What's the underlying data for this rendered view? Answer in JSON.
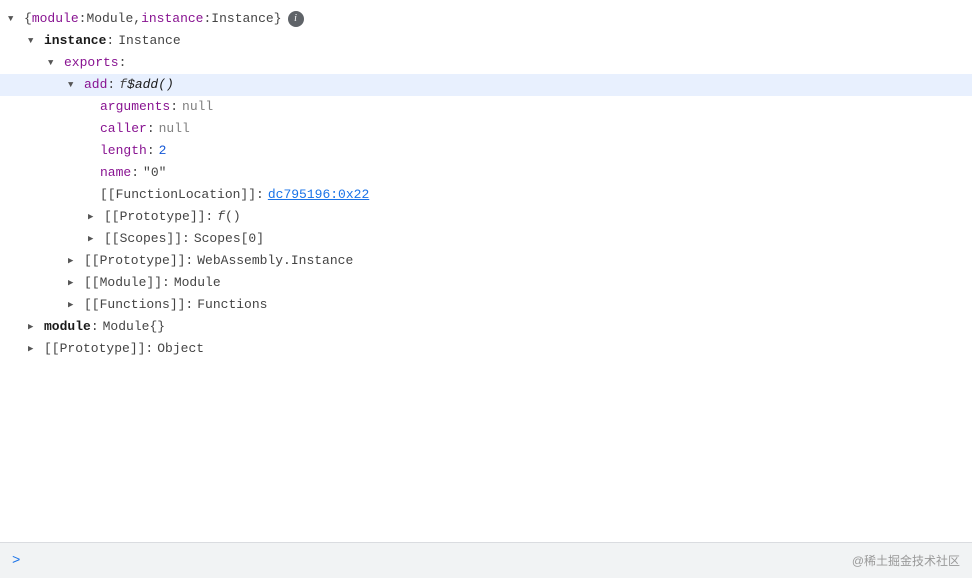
{
  "console": {
    "lines": [
      {
        "id": "root",
        "indent": "indent-0",
        "toggle": "expanded",
        "highlighted": false,
        "content": [
          {
            "type": "punctuation",
            "text": "{"
          },
          {
            "type": "key-module",
            "text": "module"
          },
          {
            "type": "punctuation",
            "text": ":"
          },
          {
            "type": "space"
          },
          {
            "type": "val-normal",
            "text": "Module"
          },
          {
            "type": "punctuation",
            "text": ","
          },
          {
            "type": "space"
          },
          {
            "type": "key-instance",
            "text": "instance"
          },
          {
            "type": "punctuation",
            "text": ":"
          },
          {
            "type": "space"
          },
          {
            "type": "val-normal",
            "text": "Instance"
          },
          {
            "type": "punctuation",
            "text": "}"
          },
          {
            "type": "info-badge",
            "text": "i"
          }
        ]
      },
      {
        "id": "instance",
        "indent": "indent-1",
        "toggle": "expanded",
        "highlighted": false,
        "content": [
          {
            "type": "key-bold",
            "text": "instance"
          },
          {
            "type": "colon",
            "text": ":"
          },
          {
            "type": "space"
          },
          {
            "type": "val-normal",
            "text": "Instance"
          }
        ]
      },
      {
        "id": "exports",
        "indent": "indent-2",
        "toggle": "expanded",
        "highlighted": false,
        "content": [
          {
            "type": "key-purple",
            "text": "exports"
          },
          {
            "type": "colon",
            "text": ":"
          }
        ]
      },
      {
        "id": "add",
        "indent": "indent-3",
        "toggle": "expanded",
        "highlighted": true,
        "content": [
          {
            "type": "key-add",
            "text": "add"
          },
          {
            "type": "colon",
            "text": ":"
          },
          {
            "type": "space"
          },
          {
            "type": "f-italic",
            "text": "f"
          },
          {
            "type": "space"
          },
          {
            "type": "val-function",
            "text": "$add()"
          }
        ]
      },
      {
        "id": "arguments",
        "indent": "indent-4",
        "toggle": "none",
        "highlighted": false,
        "content": [
          {
            "type": "key-purple",
            "text": "arguments"
          },
          {
            "type": "colon",
            "text": ":"
          },
          {
            "type": "space"
          },
          {
            "type": "val-null",
            "text": "null"
          }
        ]
      },
      {
        "id": "caller",
        "indent": "indent-4",
        "toggle": "none",
        "highlighted": false,
        "content": [
          {
            "type": "key-purple",
            "text": "caller"
          },
          {
            "type": "colon",
            "text": ":"
          },
          {
            "type": "space"
          },
          {
            "type": "val-null",
            "text": "null"
          }
        ]
      },
      {
        "id": "length",
        "indent": "indent-4",
        "toggle": "none",
        "highlighted": false,
        "content": [
          {
            "type": "key-purple",
            "text": "length"
          },
          {
            "type": "colon",
            "text": ":"
          },
          {
            "type": "space"
          },
          {
            "type": "val-number",
            "text": "2"
          }
        ]
      },
      {
        "id": "name",
        "indent": "indent-4",
        "toggle": "none",
        "highlighted": false,
        "content": [
          {
            "type": "key-purple",
            "text": "name"
          },
          {
            "type": "colon",
            "text": ":"
          },
          {
            "type": "space"
          },
          {
            "type": "val-string",
            "text": "\"0\""
          }
        ]
      },
      {
        "id": "funclocation",
        "indent": "indent-4",
        "toggle": "none",
        "highlighted": false,
        "content": [
          {
            "type": "val-normal",
            "text": "[[FunctionLocation]]"
          },
          {
            "type": "colon",
            "text": ":"
          },
          {
            "type": "space"
          },
          {
            "type": "val-link",
            "text": "dc795196:0x22"
          }
        ]
      },
      {
        "id": "prototype-func",
        "indent": "indent-4",
        "toggle": "collapsed",
        "highlighted": false,
        "content": [
          {
            "type": "val-normal",
            "text": "[[Prototype]]"
          },
          {
            "type": "colon",
            "text": ":"
          },
          {
            "type": "space"
          },
          {
            "type": "f-italic",
            "text": "f"
          },
          {
            "type": "space"
          },
          {
            "type": "val-normal",
            "text": "()"
          }
        ]
      },
      {
        "id": "scopes",
        "indent": "indent-4",
        "toggle": "collapsed",
        "highlighted": false,
        "content": [
          {
            "type": "val-normal",
            "text": "[[Scopes]]"
          },
          {
            "type": "colon",
            "text": ":"
          },
          {
            "type": "space"
          },
          {
            "type": "val-normal",
            "text": "Scopes[0]"
          }
        ]
      },
      {
        "id": "prototype-instance",
        "indent": "indent-3",
        "toggle": "collapsed",
        "highlighted": false,
        "content": [
          {
            "type": "val-normal",
            "text": "[[Prototype]]"
          },
          {
            "type": "colon",
            "text": ":"
          },
          {
            "type": "space"
          },
          {
            "type": "val-normal",
            "text": "WebAssembly.Instance"
          }
        ]
      },
      {
        "id": "module-prop",
        "indent": "indent-3",
        "toggle": "collapsed",
        "highlighted": false,
        "content": [
          {
            "type": "val-normal",
            "text": "[[Module]]"
          },
          {
            "type": "colon",
            "text": ":"
          },
          {
            "type": "space"
          },
          {
            "type": "val-normal",
            "text": "Module"
          }
        ]
      },
      {
        "id": "functions",
        "indent": "indent-3",
        "toggle": "collapsed",
        "highlighted": false,
        "content": [
          {
            "type": "val-normal",
            "text": "[[Functions]]"
          },
          {
            "type": "colon",
            "text": ":"
          },
          {
            "type": "space"
          },
          {
            "type": "val-normal",
            "text": "Functions"
          }
        ]
      },
      {
        "id": "module-root",
        "indent": "indent-1",
        "toggle": "collapsed",
        "highlighted": false,
        "content": [
          {
            "type": "key-bold",
            "text": "module"
          },
          {
            "type": "colon",
            "text": ":"
          },
          {
            "type": "space"
          },
          {
            "type": "val-normal",
            "text": "Module"
          },
          {
            "type": "space"
          },
          {
            "type": "punctuation",
            "text": "{}"
          }
        ]
      },
      {
        "id": "prototype-root",
        "indent": "indent-1",
        "toggle": "collapsed",
        "highlighted": false,
        "content": [
          {
            "type": "val-normal",
            "text": "[[Prototype]]"
          },
          {
            "type": "colon",
            "text": ":"
          },
          {
            "type": "space"
          },
          {
            "type": "val-normal",
            "text": "Object"
          }
        ]
      }
    ],
    "prompt_arrow": ">",
    "watermark": "@稀土掘金技术社区"
  }
}
